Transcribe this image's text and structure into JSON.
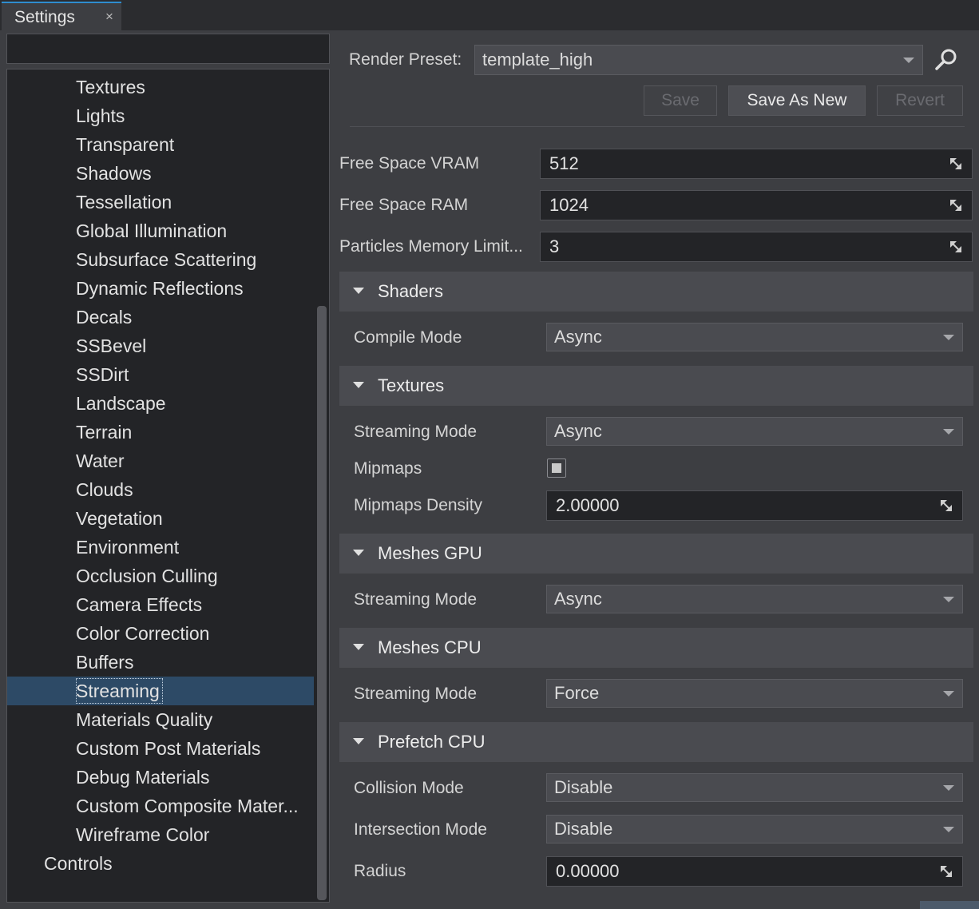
{
  "tab": {
    "label": "Settings",
    "close": "×"
  },
  "tree": {
    "items": [
      "Textures",
      "Lights",
      "Transparent",
      "Shadows",
      "Tessellation",
      "Global Illumination",
      "Subsurface Scattering",
      "Dynamic Reflections",
      "Decals",
      "SSBevel",
      "SSDirt",
      "Landscape",
      "Terrain",
      "Water",
      "Clouds",
      "Vegetation",
      "Environment",
      "Occlusion Culling",
      "Camera Effects",
      "Color Correction",
      "Buffers",
      "Streaming",
      "Materials Quality",
      "Custom Post Materials",
      "Debug Materials",
      "Custom Composite Mater...",
      "Wireframe Color",
      "Controls"
    ],
    "selected": "Streaming"
  },
  "preset": {
    "label": "Render Preset:",
    "value": "template_high",
    "icon": "search-icon"
  },
  "buttons": {
    "save": "Save",
    "save_as_new": "Save As New",
    "revert": "Revert"
  },
  "memory": {
    "vram_label": "Free Space VRAM",
    "vram_value": "512",
    "ram_label": "Free Space RAM",
    "ram_value": "1024",
    "particles_label": "Particles Memory Limit...",
    "particles_value": "3"
  },
  "sections": {
    "shaders": {
      "title": "Shaders",
      "compile_mode_label": "Compile Mode",
      "compile_mode_value": "Async"
    },
    "textures": {
      "title": "Textures",
      "streaming_mode_label": "Streaming Mode",
      "streaming_mode_value": "Async",
      "mipmaps_label": "Mipmaps",
      "mipmaps_density_label": "Mipmaps Density",
      "mipmaps_density_value": "2.00000"
    },
    "meshes_gpu": {
      "title": "Meshes GPU",
      "streaming_mode_label": "Streaming Mode",
      "streaming_mode_value": "Async"
    },
    "meshes_cpu": {
      "title": "Meshes CPU",
      "streaming_mode_label": "Streaming Mode",
      "streaming_mode_value": "Force"
    },
    "prefetch_cpu": {
      "title": "Prefetch CPU",
      "collision_mode_label": "Collision Mode",
      "collision_mode_value": "Disable",
      "intersection_mode_label": "Intersection Mode",
      "intersection_mode_value": "Disable",
      "radius_label": "Radius",
      "radius_value": "0.00000"
    }
  },
  "colors": {
    "accent": "#2f8dcf",
    "selection": "#2d4a66",
    "background": "#3d3e42",
    "field": "#232427"
  }
}
